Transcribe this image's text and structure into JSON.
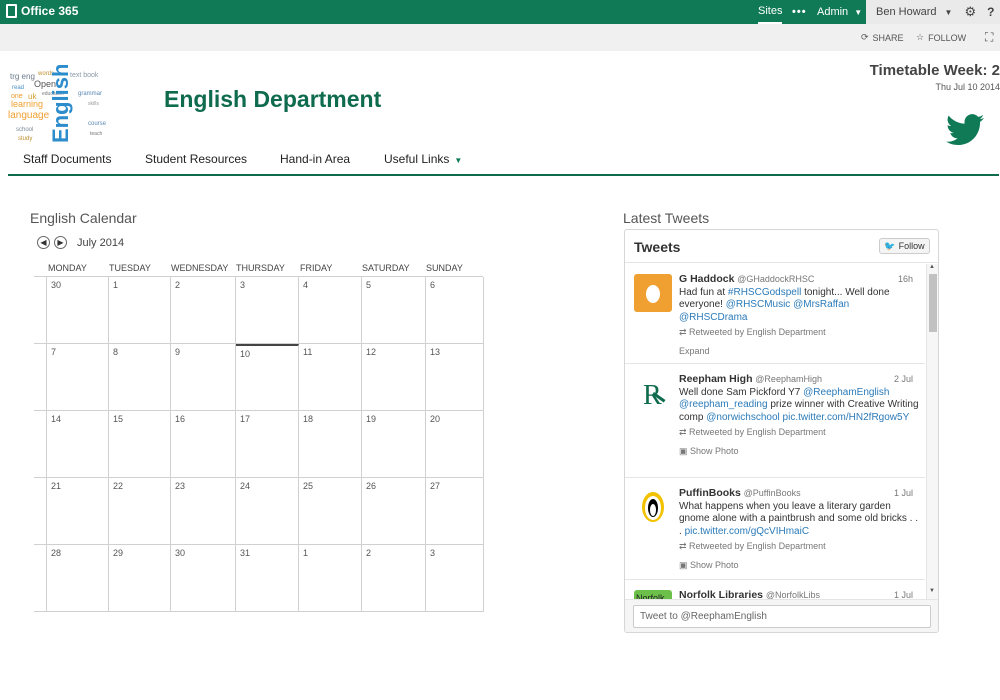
{
  "suitebar": {
    "brand": "Office 365",
    "sites": "Sites",
    "more": "•••",
    "admin": "Admin",
    "user": "Ben Howard",
    "help": "?"
  },
  "actions": {
    "share": "SHARE",
    "follow": "FOLLOW"
  },
  "site": {
    "title": "English Department",
    "timetable": "Timetable Week: 2",
    "date": "Thu Jul 10 2014"
  },
  "topnav": [
    "Staff Documents",
    "Student Resources",
    "Hand-in Area",
    "Useful Links"
  ],
  "calendar": {
    "title": "English Calendar",
    "month": "July 2014",
    "weekdays": [
      "MONDAY",
      "TUESDAY",
      "WEDNESDAY",
      "THURSDAY",
      "FRIDAY",
      "SATURDAY",
      "SUNDAY"
    ],
    "weeks": [
      [
        "30",
        "1",
        "2",
        "3",
        "4",
        "5",
        "6"
      ],
      [
        "7",
        "8",
        "9",
        "10",
        "11",
        "12",
        "13"
      ],
      [
        "14",
        "15",
        "16",
        "17",
        "18",
        "19",
        "20"
      ],
      [
        "21",
        "22",
        "23",
        "24",
        "25",
        "26",
        "27"
      ],
      [
        "28",
        "29",
        "30",
        "31",
        "1",
        "2",
        "3"
      ]
    ],
    "today": "10"
  },
  "tweets": {
    "section_title": "Latest Tweets",
    "header": "Tweets",
    "follow": "Follow",
    "input_placeholder": "Tweet to @ReephamEnglish",
    "items": [
      {
        "name": "G Haddock",
        "handle": "@GHaddockRHSC",
        "time": "16h",
        "text_parts": [
          {
            "t": "Had fun at "
          },
          {
            "t": "#RHSCGodspell",
            "link": true
          },
          {
            "t": " tonight... Well done everyone! "
          },
          {
            "t": "@RHSCMusic",
            "link": true
          },
          {
            "t": " "
          },
          {
            "t": "@MrsRaffan",
            "link": true
          },
          {
            "t": " "
          },
          {
            "t": "@RHSCDrama",
            "link": true
          }
        ],
        "retweet": "Retweeted by English Department",
        "action": "Expand",
        "avatar_color": "#f0a030"
      },
      {
        "name": "Reepham High",
        "handle": "@ReephamHigh",
        "time": "2 Jul",
        "text_parts": [
          {
            "t": "Well done Sam Pickford Y7 "
          },
          {
            "t": "@ReephamEnglish",
            "link": true
          },
          {
            "t": " "
          },
          {
            "t": "@reepham_reading",
            "link": true
          },
          {
            "t": " prize winner with Creative Writing comp "
          },
          {
            "t": "@norwichschool",
            "link": true
          },
          {
            "t": " "
          },
          {
            "t": "pic.twitter.com/HN2fRgow5Y",
            "link": true
          }
        ],
        "retweet": "Retweeted by English Department",
        "action": "Show Photo",
        "avatar_color": "#0f6b4e"
      },
      {
        "name": "PuffinBooks",
        "handle": "@PuffinBooks",
        "time": "1 Jul",
        "text_parts": [
          {
            "t": "What happens when you leave a literary garden gnome alone with a paintbrush and some old bricks . . . "
          },
          {
            "t": "pic.twitter.com/gQcVIHmaiC",
            "link": true
          }
        ],
        "retweet": "Retweeted by English Department",
        "action": "Show Photo",
        "avatar_color": "#ffffff"
      },
      {
        "name": "Norfolk Libraries",
        "handle": "@NorfolkLibs",
        "time": "1 Jul",
        "text_parts": [],
        "retweet": "",
        "action": "",
        "avatar_label": "Norfolk",
        "avatar_color": "#6cc04a"
      }
    ]
  }
}
